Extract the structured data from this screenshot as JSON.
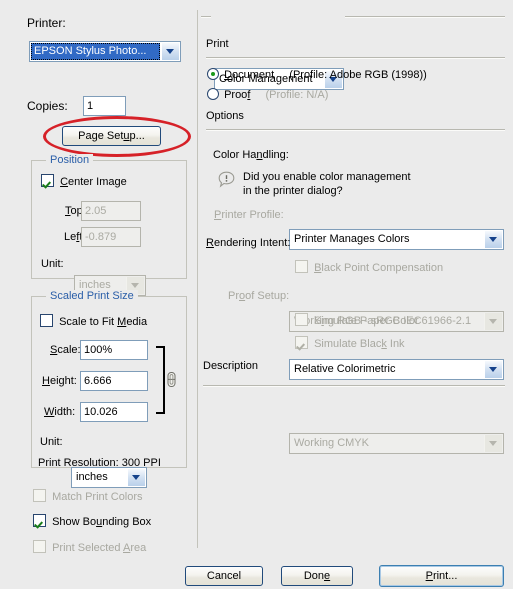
{
  "dialog": {
    "background": "#ebebeb",
    "accent_group_title": "#2a5ea8",
    "annotation_color": "#d62128"
  },
  "left": {
    "printer_label": "Printer:",
    "printer_value": "EPSON Stylus Photo...",
    "copies_label": "Copies:",
    "copies_value": "1",
    "page_setup_button": "Page Setup...",
    "position": {
      "title": "Position",
      "center_image_label": "Center Image",
      "center_image_checked": true,
      "top_label": "Top:",
      "top_value": "2.05",
      "left_label": "Left:",
      "left_value": "-0.879",
      "unit_label": "Unit:",
      "unit_value": "inches"
    },
    "scaled_print_size": {
      "title": "Scaled Print Size",
      "scale_to_fit_label": "Scale to Fit Media",
      "scale_to_fit_checked": false,
      "scale_label": "Scale:",
      "scale_value": "100%",
      "height_label": "Height:",
      "height_value": "6.666",
      "width_label": "Width:",
      "width_value": "10.026",
      "unit_label": "Unit:",
      "unit_value": "inches",
      "print_resolution": "Print Resolution: 300 PPI",
      "link_icon": "chain-link-icon"
    },
    "options": [
      {
        "label": "Match Print Colors",
        "checked": false,
        "enabled": false
      },
      {
        "label": "Show Bounding Box",
        "checked": true,
        "enabled": true
      },
      {
        "label": "Print Selected Area",
        "checked": false,
        "enabled": false
      }
    ]
  },
  "right": {
    "section_combo_value": "Color Management",
    "print_heading": "Print",
    "document_radio_label": "Document",
    "document_profile": "(Profile: Adobe RGB (1998))",
    "document_selected": true,
    "proof_radio_label": "Proof",
    "proof_profile": "(Profile: N/A)",
    "proof_selected": false,
    "options_heading": "Options",
    "color_handling_label": "Color Handling:",
    "color_handling_value": "Printer Manages Colors",
    "warning_icon": "warning-callout-icon",
    "warning_line1": "Did you enable color management",
    "warning_line2": "in the printer dialog?",
    "printer_profile_label": "Printer Profile:",
    "printer_profile_value": "Working RGB - sRGB IEC61966-2.1",
    "rendering_intent_label": "Rendering Intent:",
    "rendering_intent_value": "Relative Colorimetric",
    "black_point_label": "Black Point Compensation",
    "black_point_checked": false,
    "proof_setup_label": "Proof Setup:",
    "proof_setup_value": "Working CMYK",
    "simulate_paper_label": "Simulate Paper Color",
    "simulate_paper_checked": false,
    "simulate_black_label": "Simulate Black Ink",
    "simulate_black_checked": true,
    "description_heading": "Description"
  },
  "footer": {
    "cancel": "Cancel",
    "done": "Done",
    "print": "Print..."
  }
}
